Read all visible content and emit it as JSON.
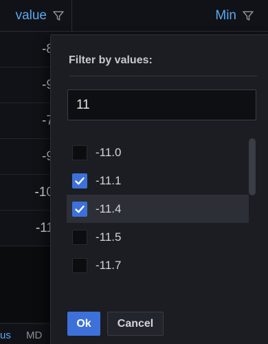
{
  "table": {
    "columns": [
      {
        "label": "value",
        "icon": "filter-icon"
      },
      {
        "label": "Min",
        "icon": "filter-icon"
      }
    ],
    "visible_values": [
      "-8",
      "-9",
      "-7",
      "-9",
      "-10",
      "-11"
    ]
  },
  "footer_tabs": {
    "active": "us",
    "other": "MD"
  },
  "filter_popup": {
    "title": "Filter by values:",
    "search_value": "11",
    "items": [
      {
        "label": "-11.0",
        "checked": false
      },
      {
        "label": "-11.1",
        "checked": true
      },
      {
        "label": "-11.4",
        "checked": true
      },
      {
        "label": "-11.5",
        "checked": false
      },
      {
        "label": "-11.7",
        "checked": false
      }
    ],
    "ok_label": "Ok",
    "cancel_label": "Cancel"
  },
  "colors": {
    "accent": "#5aa9f0",
    "primary_button": "#3d71d9",
    "background": "#111217",
    "popup": "#1b1d22"
  }
}
